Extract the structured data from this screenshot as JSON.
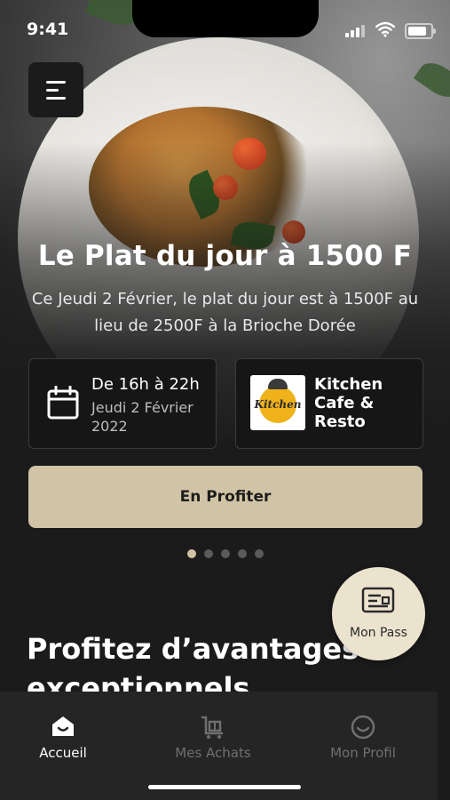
{
  "status": {
    "time": "9:41"
  },
  "hero": {
    "title": "Le Plat du jour à 1500 F",
    "description": "Ce Jeudi 2 Février, le plat du jour est à 1500F au lieu de 2500F à la Brioche Dorée"
  },
  "schedule": {
    "hours": "De 16h à 22h",
    "date": "Jeudi 2 Février 2022"
  },
  "restaurant": {
    "logo_text": "Kitchen",
    "name": "Kitchen Cafe & Resto"
  },
  "cta": {
    "label": "En Profiter"
  },
  "carousel": {
    "count": 5,
    "active_index": 0
  },
  "section": {
    "title": "Profitez d’avantages exceptionnels"
  },
  "pass_button": {
    "label": "Mon Pass",
    "icon": "id-card-icon"
  },
  "tabbar": {
    "tabs": [
      {
        "label": "Accueil",
        "icon": "home-icon",
        "active": true
      },
      {
        "label": "Mes Achats",
        "icon": "shopping-cart-icon",
        "active": false
      },
      {
        "label": "Mon Profil",
        "icon": "smiley-icon",
        "active": false
      }
    ]
  },
  "colors": {
    "accent": "#d1c4a6",
    "background": "#1b1b1b",
    "tabbar": "#252525",
    "inactive_tab": "#6f6f6f"
  }
}
